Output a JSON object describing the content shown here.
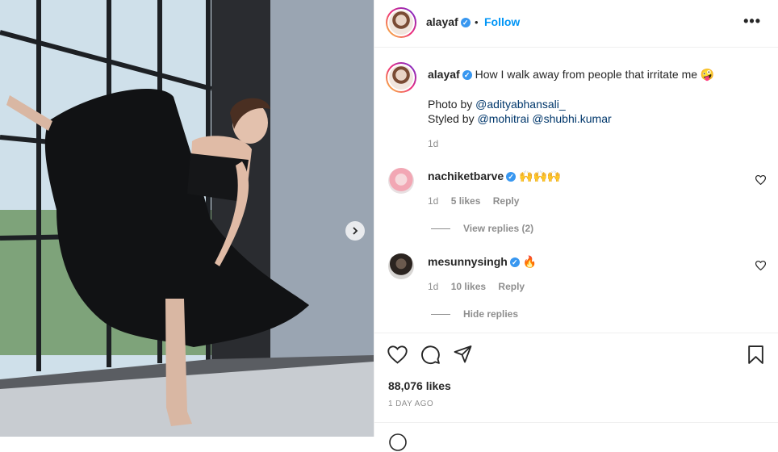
{
  "post": {
    "username": "alayaf",
    "follow_label": "Follow",
    "separator": "•",
    "more_label": "•••",
    "caption": "How I walk away from people that irritate me 🤪",
    "credit_photo_prefix": "Photo by ",
    "credit_photo_user": "@adityabhansali_",
    "credit_styled_prefix": "Styled by ",
    "credit_styled_user1": "@mohitrai",
    "credit_styled_user2": "@shubhi.kumar",
    "caption_time": "1d",
    "likes": "88,076 likes",
    "time_ago": "1 DAY AGO"
  },
  "comments": [
    {
      "username": "nachiketbarve",
      "text": "🙌🙌🙌",
      "time": "1d",
      "likes": "5 likes",
      "reply_label": "Reply",
      "replies_toggle": "View replies (2)"
    },
    {
      "username": "mesunnysingh",
      "text": "🔥",
      "time": "1d",
      "likes": "10 likes",
      "reply_label": "Reply",
      "replies_toggle": "Hide replies"
    }
  ],
  "icons": {
    "verified": "verified-badge-icon",
    "like": "heart-icon",
    "comment": "comment-icon",
    "share": "paper-plane-icon",
    "save": "bookmark-icon",
    "next": "chevron-right-icon"
  },
  "colors": {
    "accent": "#0095f6",
    "verified": "#3897f0",
    "muted": "#8e8e8e",
    "text": "#262626"
  }
}
